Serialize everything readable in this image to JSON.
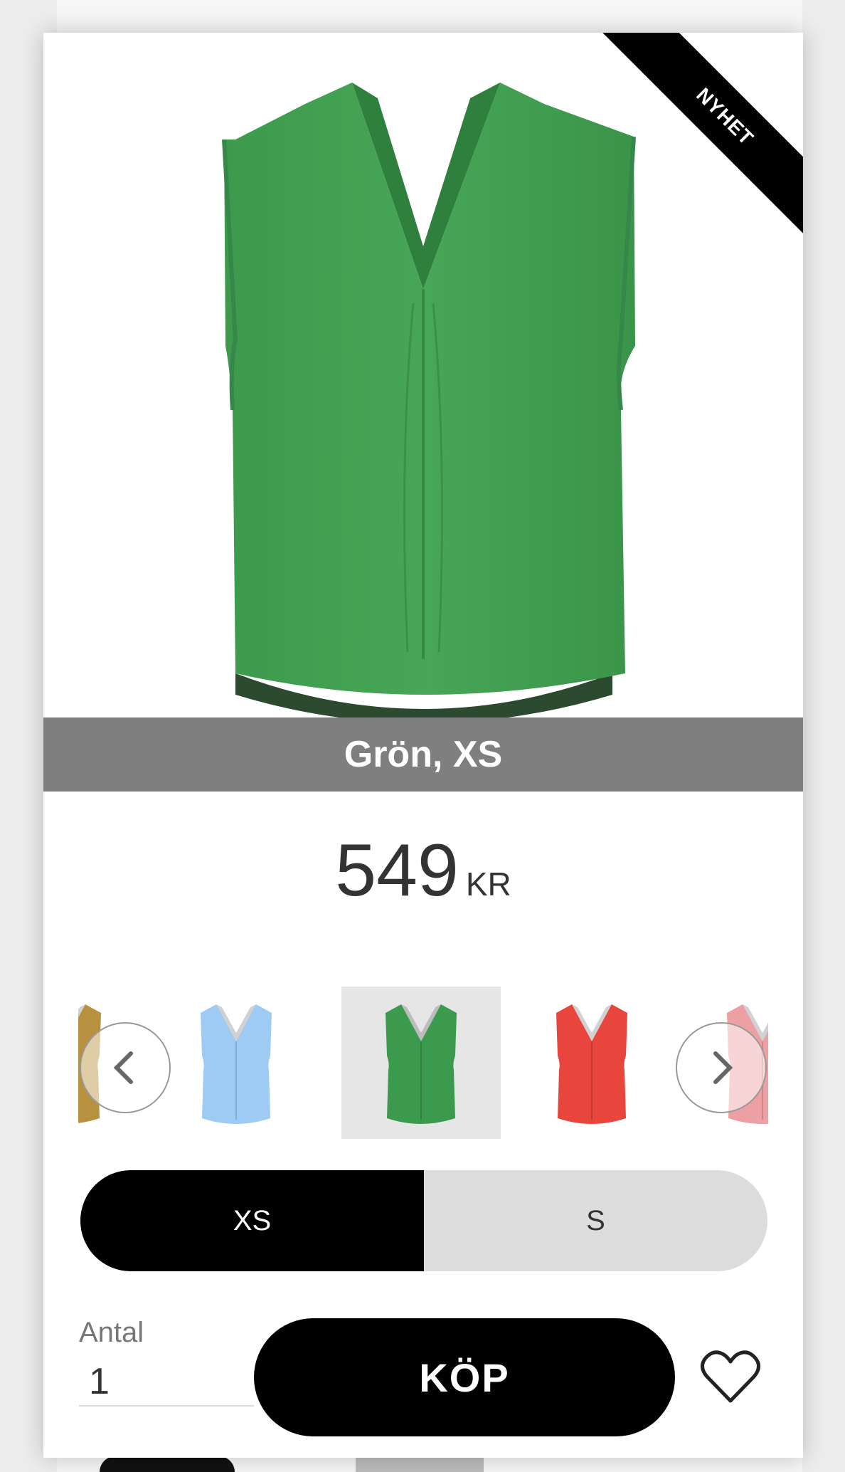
{
  "product": {
    "badge": "NYHET",
    "variant_label": "Grön, XS",
    "price": "549",
    "currency": "KR"
  },
  "carousel": {
    "thumbnails": [
      {
        "color_name": "mustard",
        "color": "#b8913f",
        "selected": false
      },
      {
        "color_name": "light-blue",
        "color": "#9ecbf4",
        "selected": false
      },
      {
        "color_name": "green",
        "color": "#3c9a4e",
        "selected": true
      },
      {
        "color_name": "red",
        "color": "#e8453c",
        "selected": false
      },
      {
        "color_name": "pink",
        "color": "#eda0a3",
        "selected": false
      }
    ],
    "prev_icon": "chevron-left-icon",
    "next_icon": "chevron-right-icon"
  },
  "sizes": [
    {
      "label": "XS",
      "selected": true
    },
    {
      "label": "S",
      "selected": false
    }
  ],
  "purchase": {
    "quantity_label": "Antal",
    "quantity_value": "1",
    "buy_label": "KÖP",
    "favorite_icon": "heart-icon"
  },
  "colors": {
    "product_green": "#43a153",
    "variant_bar": "#7f7f7f",
    "black": "#000000"
  }
}
